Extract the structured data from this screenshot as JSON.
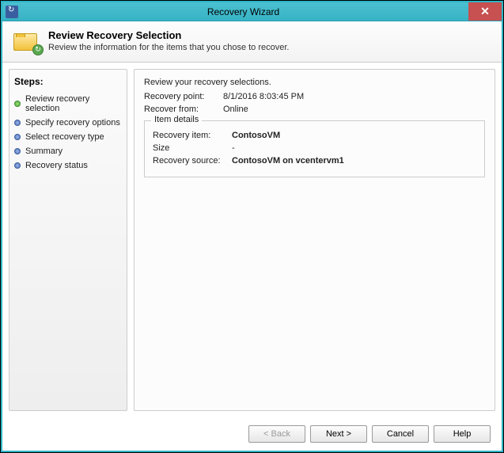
{
  "window": {
    "title": "Recovery Wizard"
  },
  "header": {
    "title": "Review Recovery Selection",
    "subtitle": "Review the information for the items that you chose to recover."
  },
  "sidebar": {
    "heading": "Steps:",
    "items": [
      {
        "label": "Review recovery selection",
        "current": true
      },
      {
        "label": "Specify recovery options",
        "current": false
      },
      {
        "label": "Select recovery type",
        "current": false
      },
      {
        "label": "Summary",
        "current": false
      },
      {
        "label": "Recovery status",
        "current": false
      }
    ]
  },
  "content": {
    "intro": "Review your recovery selections.",
    "recovery_point_label": "Recovery point:",
    "recovery_point_value": "8/1/2016 8:03:45 PM",
    "recover_from_label": "Recover from:",
    "recover_from_value": "Online",
    "details": {
      "legend": "Item details",
      "recovery_item_label": "Recovery item:",
      "recovery_item_value": "ContosoVM",
      "size_label": "Size",
      "size_value": "-",
      "recovery_source_label": "Recovery source:",
      "recovery_source_value": "ContosoVM on vcentervm1"
    }
  },
  "footer": {
    "back": "< Back",
    "next": "Next >",
    "cancel": "Cancel",
    "help": "Help"
  }
}
